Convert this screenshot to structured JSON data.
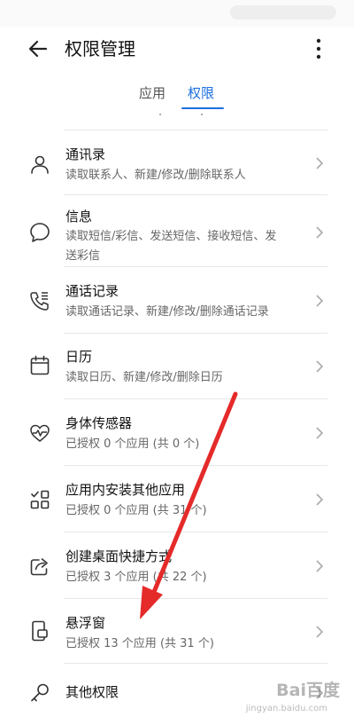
{
  "header": {
    "title": "权限管理"
  },
  "tabs": [
    {
      "label": "应用"
    },
    {
      "label": "权限"
    }
  ],
  "permissions": [
    {
      "name": "通讯录",
      "desc": "读取联系人、新建/修改/删除联系人",
      "icon": "contacts-icon"
    },
    {
      "name": "信息",
      "desc_line1": "读取短信/彩信、发送短信、接收短信、发",
      "desc_line2": "送彩信",
      "icon": "message-icon"
    },
    {
      "name": "通话记录",
      "desc": "读取通话记录、新建/修改/删除通话记录",
      "icon": "call-log-icon"
    },
    {
      "name": "日历",
      "desc": "读取日历、新建/修改/删除日历",
      "icon": "calendar-icon"
    },
    {
      "name": "身体传感器",
      "desc": "已授权 0 个应用 (共 0 个)",
      "icon": "heart-sensor-icon"
    },
    {
      "name": "应用内安装其他应用",
      "desc": "已授权 0 个应用 (共 31 个)",
      "icon": "app-grid-icon"
    },
    {
      "name": "创建桌面快捷方式",
      "desc": "已授权 3 个应用 (共 22 个)",
      "icon": "shortcut-icon"
    },
    {
      "name": "悬浮窗",
      "desc": "已授权 13 个应用 (共 31 个)",
      "icon": "floating-window-icon"
    },
    {
      "name": "其他权限",
      "icon": "key-icon"
    }
  ],
  "colors": {
    "accent": "#1d6fdf",
    "annotation_arrow": "#e52a2a"
  },
  "watermark": {
    "brand": "Bai百度",
    "url": "jingyan.baidu.com"
  }
}
